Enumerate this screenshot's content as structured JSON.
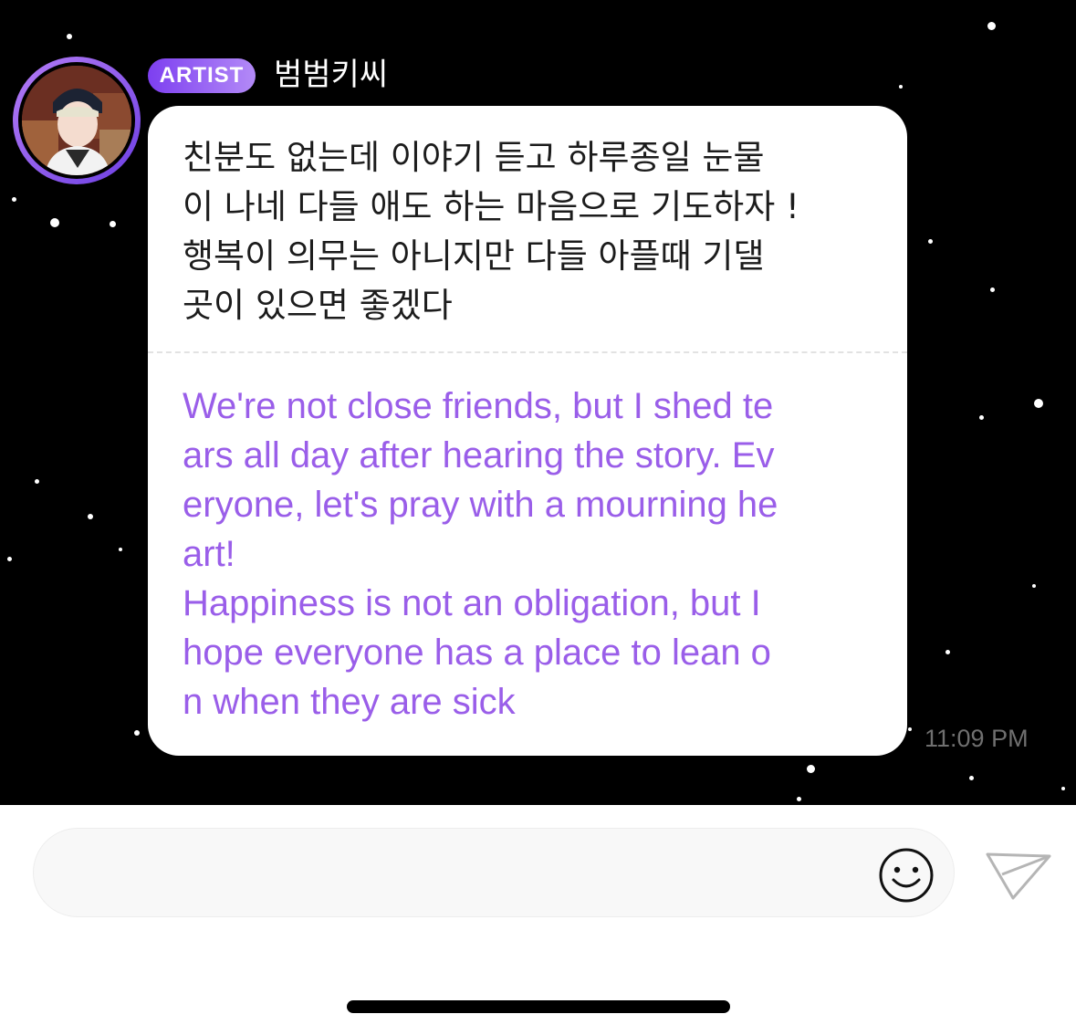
{
  "message": {
    "badge": "ARTIST",
    "sender": "범범키씨",
    "original_text": "친분도 없는데 이야기 듣고 하루종일 눈물\n이 나네 다들 애도 하는 마음으로 기도하자 !\n행복이 의무는 아니지만 다들 아플때 기댈\n곳이 있으면 좋겠다",
    "translated_text": "We're not close friends, but I shed te\nars all day after hearing the story. Ev\neryone, let's pray with a mourning he\nart!\nHappiness is not an obligation, but I\nhope everyone has a place to lean o\nn when they are sick",
    "time": "11:09 PM"
  },
  "composer": {
    "placeholder": "",
    "emoji_icon": "smiley-face-icon",
    "send_icon": "paper-plane-icon"
  },
  "colors": {
    "chat_background": "#000000",
    "badge_gradient_start": "#7d3ff0",
    "badge_gradient_end": "#b38af7",
    "translation_text": "#9a5ee9",
    "bubble": "#ffffff"
  }
}
